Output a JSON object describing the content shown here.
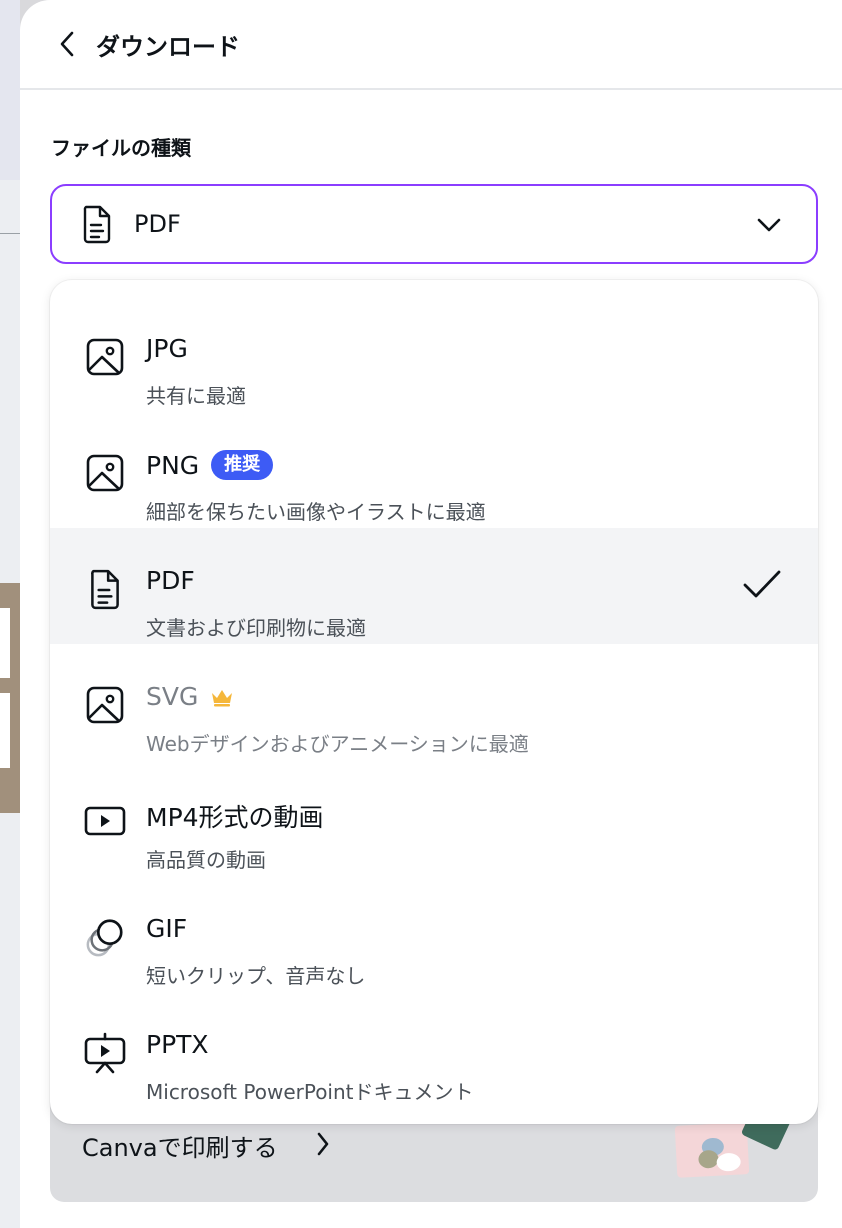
{
  "header": {
    "title": "ダウンロード"
  },
  "file_type": {
    "label": "ファイルの種類",
    "selected": "PDF"
  },
  "print": {
    "label": "Canvaで印刷する"
  },
  "options": [
    {
      "title": "JPG",
      "desc": "共有に最適",
      "icon": "image-icon"
    },
    {
      "title": "PNG",
      "desc": "細部を保ちたい画像やイラストに最適",
      "icon": "image-icon",
      "badge": "推奨"
    },
    {
      "title": "PDF",
      "desc": "文書および印刷物に最適",
      "icon": "document-icon",
      "selected": true
    },
    {
      "title": "SVG",
      "desc": "Webデザインおよびアニメーションに最適",
      "icon": "image-icon",
      "premium": true
    },
    {
      "title": "MP4形式の動画",
      "desc": "高品質の動画",
      "icon": "video-icon"
    },
    {
      "title": "GIF",
      "desc": "短いクリップ、音声なし",
      "icon": "gif-icon"
    },
    {
      "title": "PPTX",
      "desc": "Microsoft PowerPointドキュメント",
      "icon": "presentation-icon"
    }
  ],
  "colors": {
    "accent": "#8b3dff",
    "badge": "#3d5bf5",
    "crown": "#f5b73b",
    "selected_row": "#f3f4f6"
  }
}
